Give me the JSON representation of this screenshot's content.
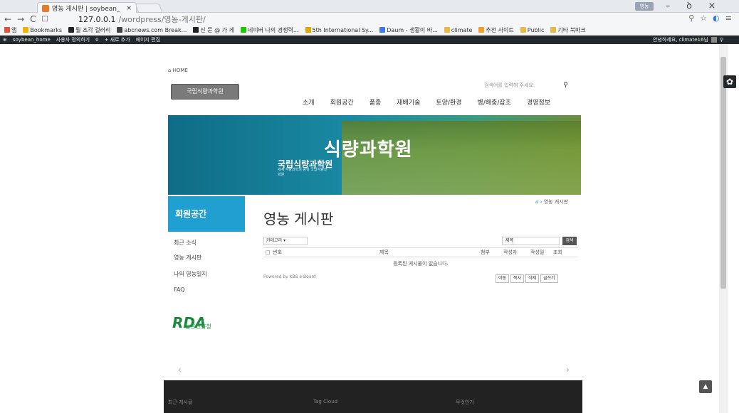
{
  "browser": {
    "tab_title": "영농 게시판 | soybean_",
    "tab_close": "×",
    "profile_label": "영농",
    "win_min": "–",
    "win_max": "ꝺ",
    "win_close": "×",
    "url_host": "127.0.0.1",
    "url_path": "/wordpress/영농-게시판/",
    "bookmarks": [
      {
        "label": "앱",
        "color": "#e0533d"
      },
      {
        "label": "Bookmarks",
        "color": "#f0b400"
      },
      {
        "label": "될 조각 걸러리",
        "color": "#222"
      },
      {
        "label": "abcnews.com Break...",
        "color": "#444"
      },
      {
        "label": "신 문 @ 가 게",
        "color": "#222"
      },
      {
        "label": "네이버 나의 경쟁력...",
        "color": "#1ec800"
      },
      {
        "label": "5th International Sy...",
        "color": "#e3a500"
      },
      {
        "label": "Daum - 생활이 바...",
        "color": "#3b7be9"
      },
      {
        "label": "climate",
        "color": "#e7b84a"
      },
      {
        "label": "추천 사이트",
        "color": "#f29d30"
      },
      {
        "label": "Public",
        "color": "#e7b84a"
      },
      {
        "label": "기타 북마크",
        "color": "#e7b84a"
      }
    ]
  },
  "adminbar": {
    "items": [
      "soybean_home",
      "사용자 정의하기",
      "0",
      "+ 새로 추가",
      "페이지 편집"
    ],
    "greeting": "안녕하세요, climate16님"
  },
  "site": {
    "breadcrumb_home": "HOME",
    "logo_text": "국립식량과학원",
    "search_placeholder": "검색어를 입력해 주세요.",
    "menu": [
      "소개",
      "회원공간",
      "품종",
      "재배기술",
      "토양/환경",
      "병/해충/잡초",
      "경영정보"
    ],
    "banner_title": "식량과학원",
    "banner_sub": "국립식량과학원",
    "banner_small": "세계 식량과학의 중심 국립식량과학원"
  },
  "sidebar": {
    "heading": "회원공간",
    "items": [
      "최근 소식",
      "영농 게시판",
      "나의 영농일지",
      "FAQ"
    ],
    "rda_logo": "RDA",
    "rda_name": "농촌진흥청"
  },
  "board": {
    "crumb": "영농 게시판",
    "title": "영농 게시판",
    "category_select": "카테고리",
    "title_select": "제목",
    "search_button": "검색",
    "columns": [
      "번호",
      "제목",
      "첨부",
      "작성자",
      "작성일",
      "조회"
    ],
    "empty_message": "등록된 게시물이 없습니다.",
    "powered_by": "Powered by KBS e-Board",
    "actions": [
      "이동",
      "복사",
      "삭제",
      "글쓰기"
    ]
  },
  "footer": {
    "cols": [
      "최근 게시글",
      "Tag Cloud",
      "무엇인가"
    ]
  }
}
